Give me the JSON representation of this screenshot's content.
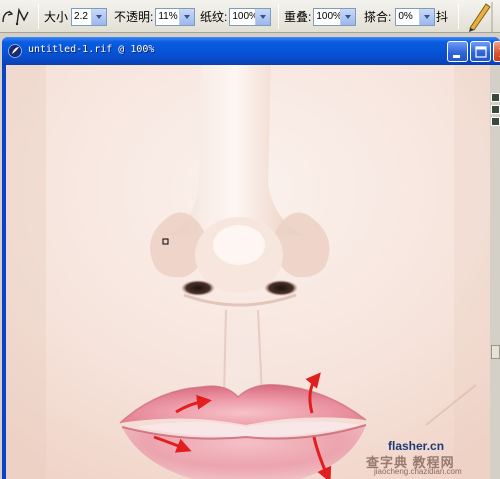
{
  "toolbar": {
    "size_label": "大小",
    "size_value": "2.2",
    "opacity_label": "不透明:",
    "opacity_value": "11%",
    "grain_label": "纸纹:",
    "grain_value": "100%",
    "overlap_label": "重叠:",
    "overlap_value": "100%",
    "blend_label": "搽合:",
    "blend_value": "0%",
    "jitter_label": "抖"
  },
  "window": {
    "title": "untitled-1.rif @ 100%"
  },
  "watermark": {
    "brand": "flasher.cn",
    "site_name": "查字典 教程网",
    "url": "jiaocheng.chazidian.com"
  },
  "colors": {
    "title_bar": "#0653d7",
    "toolbar_bg": "#ece9d8",
    "skin": "#f5e7df",
    "lip": "#e8889a",
    "arrow": "#e11f1f"
  }
}
